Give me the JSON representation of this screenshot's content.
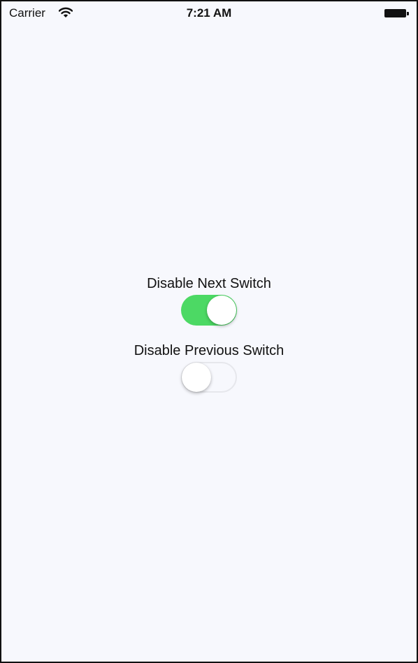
{
  "status_bar": {
    "carrier": "Carrier",
    "time": "7:21 AM",
    "wifi_icon": "wifi-icon",
    "battery_icon": "battery-icon"
  },
  "switches": [
    {
      "label": "Disable Next Switch",
      "state": "on",
      "color": "#4cd964"
    },
    {
      "label": "Disable Previous Switch",
      "state": "off"
    }
  ],
  "colors": {
    "background": "#f7f8fd",
    "switch_on": "#4cd964"
  }
}
